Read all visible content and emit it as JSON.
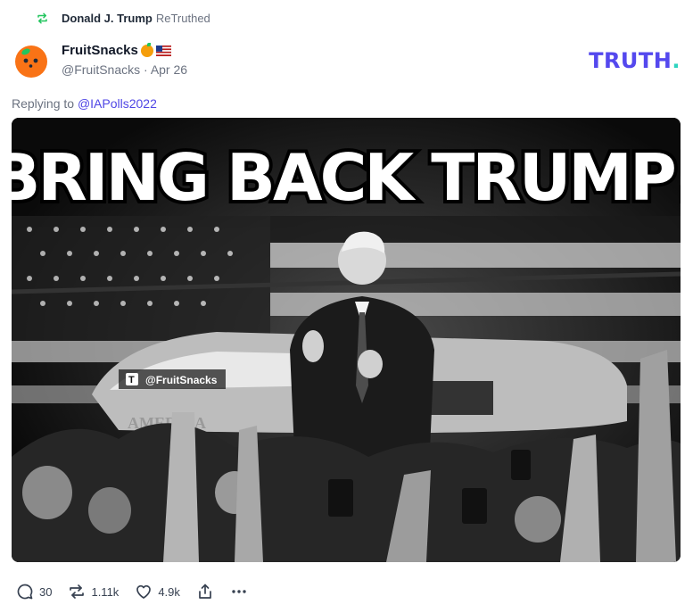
{
  "retruth": {
    "icon": "retruth-icon",
    "user": "Donald J. Trump",
    "suffix": "ReTruthed"
  },
  "author": {
    "display_name": "FruitSnacks",
    "badges": [
      "orange-emoji",
      "us-flag-emoji"
    ],
    "handle": "@FruitSnacks",
    "separator": "·",
    "date": "Apr 26"
  },
  "brand": {
    "logo_text": "TRUTH",
    "logo_dot": ".",
    "color": "#5448ee",
    "dot_color": "#2dd4bf"
  },
  "reply": {
    "prefix": "Replying to",
    "mention": "@IAPolls2022"
  },
  "media": {
    "headline": "BRING BACK TRUMP!",
    "watermark": "@FruitSnacks",
    "aircraft_text": "AMERICA"
  },
  "actions": {
    "replies": "30",
    "retruths": "1.11k",
    "likes": "4.9k"
  }
}
